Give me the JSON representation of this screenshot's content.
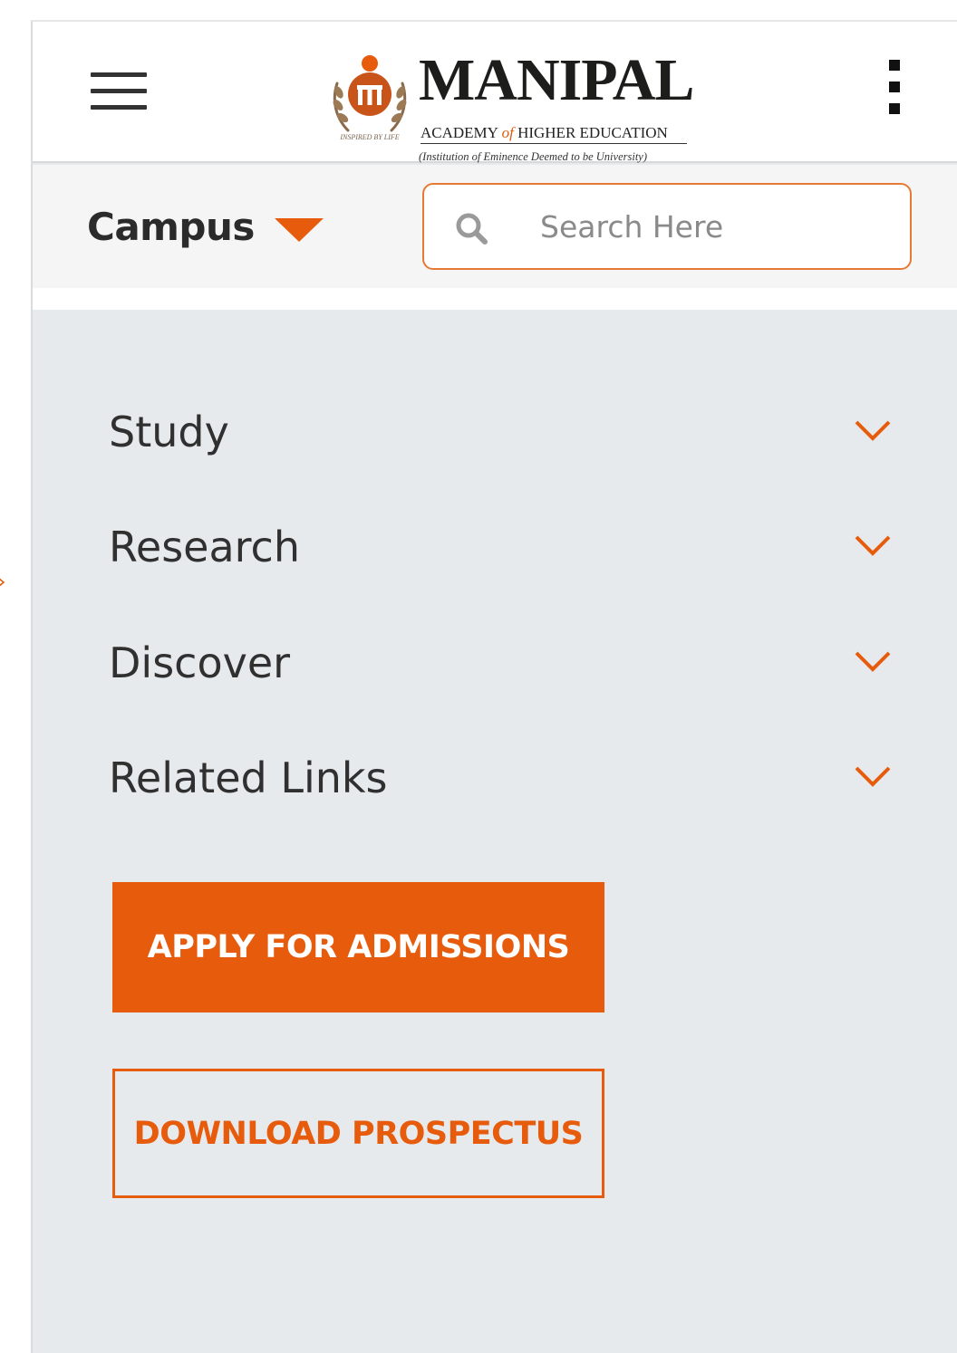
{
  "header": {
    "logo": {
      "title": "MANIPAL",
      "subtitle_pre": "ACADEMY ",
      "subtitle_of": "of",
      "subtitle_post": " HIGHER EDUCATION",
      "tagline": "(Institution of Eminence Deemed to be University)",
      "emblem_text": "INSPIRED BY LIFE"
    },
    "menu_icon": "hamburger-icon",
    "more_icon": "kebab-menu-icon"
  },
  "subbar": {
    "campus_label": "Campus",
    "campus_icon": "caret-down-icon",
    "search": {
      "placeholder": "Search Here",
      "value": "",
      "icon": "search-icon"
    }
  },
  "menu": {
    "items": [
      {
        "label": "Study",
        "icon": "chevron-down-icon"
      },
      {
        "label": "Research",
        "icon": "chevron-down-icon"
      },
      {
        "label": "Discover",
        "icon": "chevron-down-icon"
      },
      {
        "label": "Related Links",
        "icon": "chevron-down-icon"
      }
    ]
  },
  "actions": {
    "apply_label": "APPLY FOR ADMISSIONS",
    "prospectus_label": "DOWNLOAD PROSPECTUS"
  },
  "colors": {
    "accent": "#e65c0c",
    "panel_bg": "#e7eaec",
    "text": "#303030"
  }
}
